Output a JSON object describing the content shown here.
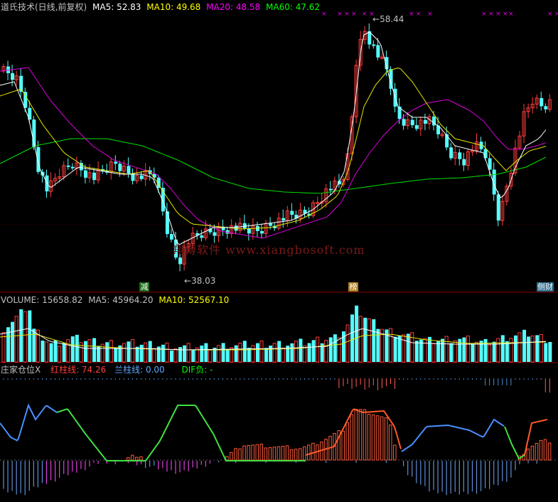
{
  "price_panel": {
    "title": "道氏技术(日线,前复权)",
    "ma5_label": "MA5: 52.83",
    "ma10_label": "MA10: 49.68",
    "ma20_label": "MA20: 48.58",
    "ma60_label": "MA60: 47.62",
    "high_marker": "58.44",
    "low_marker": "38.03",
    "watermark": "翔博软件 www.xiangbosoft.com",
    "badges": [
      "减",
      "榜",
      "侧财"
    ],
    "colors": {
      "ma5": "#ffffff",
      "ma10": "#ffff00",
      "ma20": "#ff00ff",
      "ma60": "#00ff00"
    }
  },
  "volume_panel": {
    "label_volume": "VOLUME: 15658.82",
    "label_ma5": "MA5: 45964.20",
    "label_ma10": "MA10: 52567.10"
  },
  "indicator_panel": {
    "title": "庄家仓位X",
    "label_red": "红柱线: 74.26",
    "label_blue": "兰柱线: 0.00",
    "label_dif": "DIF负: -"
  },
  "chart_data": {
    "type": "candlestick",
    "price_levels": {
      "high": 58.44,
      "low": 38.03
    },
    "ma_last": {
      "MA5": 52.83,
      "MA10": 49.68,
      "MA20": 48.58,
      "MA60": 47.62
    },
    "volume_last": {
      "VOLUME": 15658.82,
      "MA5": 45964.2,
      "MA10": 52567.1
    },
    "indicator_last": {
      "red_bar": 74.26,
      "blue_bar": 0.0
    }
  }
}
